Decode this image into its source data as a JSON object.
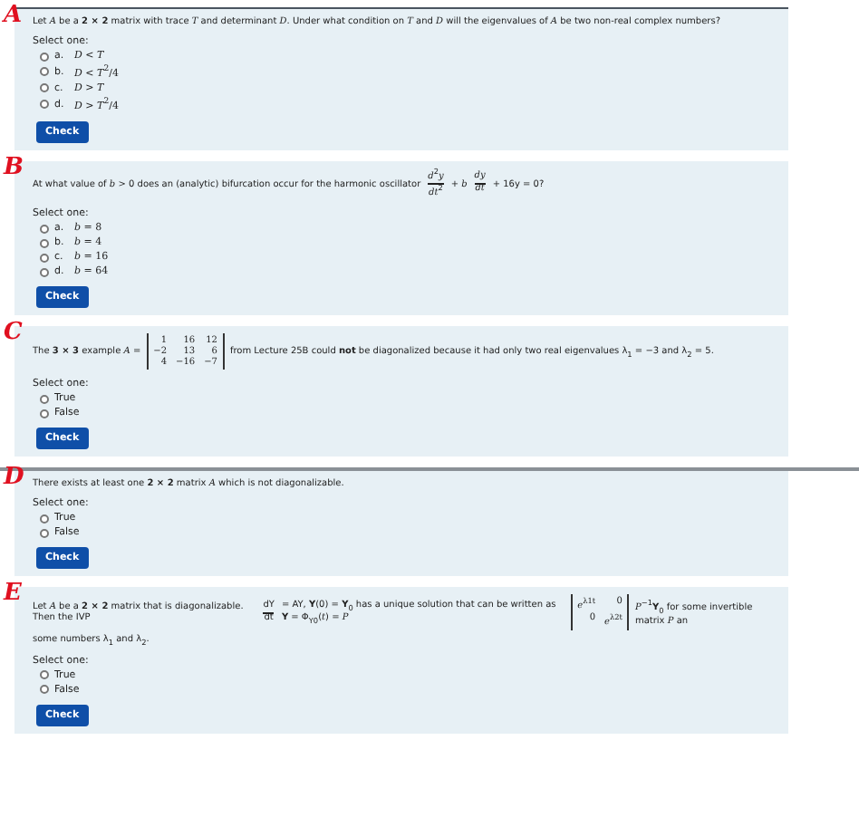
{
  "questions": [
    {
      "annotation": "A",
      "lines": [
        [
          {
            "kind": "text",
            "text": "Let *A* be a **2 × 2** matrix with trace *T* and determinant *D*. Under what condition on *T* and *D* will the eigenvalues of *A* be two non-real complex numbers?"
          }
        ]
      ],
      "select_label": "Select one:",
      "options": [
        {
          "letter": "a.",
          "text": "*D* < *T*",
          "selected": false
        },
        {
          "letter": "b.",
          "text": "*D* < *T*$^{2}$/4",
          "selected": false
        },
        {
          "letter": "c.",
          "text": "*D* > *T*",
          "selected": false
        },
        {
          "letter": "d.",
          "text": "*D* > *T*$^{2}$/4",
          "selected": false
        }
      ],
      "button": "Check"
    },
    {
      "annotation": "B",
      "lines": [
        [
          {
            "kind": "text",
            "text": "At what value of *b* > 0 does an (analytic) bifurcation occur for the harmonic oscillator"
          },
          {
            "kind": "fraction",
            "numerator": "*d*$^{2}$*y*",
            "denominator": "*dt*$^{2}$"
          },
          {
            "kind": "text",
            "text": "+ *b*"
          },
          {
            "kind": "fraction",
            "numerator": "*dy*",
            "denominator": "*dt*"
          },
          {
            "kind": "text",
            "text": "+ 16y = 0?"
          }
        ]
      ],
      "select_label": "Select one:",
      "options": [
        {
          "letter": "a.",
          "text": "*b* = 8",
          "selected": false
        },
        {
          "letter": "b.",
          "text": "*b* = 4",
          "selected": false
        },
        {
          "letter": "c.",
          "text": "*b* = 16",
          "selected": false
        },
        {
          "letter": "d.",
          "text": "*b* = 64",
          "selected": false
        }
      ],
      "button": "Check"
    },
    {
      "annotation": "C",
      "lines": [
        [
          {
            "kind": "text",
            "text": "The **3 × 3** example *A* ="
          },
          {
            "kind": "matrix",
            "rows": [
              [
                "1",
                "16",
                "12"
              ],
              [
                "−2",
                "13",
                "6"
              ],
              [
                "4",
                "−16",
                "−7"
              ]
            ]
          },
          {
            "kind": "text",
            "text": "from Lecture 25B could **not** be diagonalized because it had only two real eigenvalues λ$_{1}$ = −3 and λ$_{2}$ = 5."
          }
        ]
      ],
      "select_label": "Select one:",
      "options": [
        {
          "text": "True",
          "selected": false
        },
        {
          "text": "False",
          "selected": false
        }
      ],
      "button": "Check"
    },
    {
      "annotation": "D",
      "lines": [
        [
          {
            "kind": "text",
            "text": "There exists at least one **2 × 2** matrix *A* which is not diagonalizable."
          }
        ]
      ],
      "select_label": "Select one:",
      "options": [
        {
          "text": "True",
          "selected": false
        },
        {
          "text": "False",
          "selected": false
        }
      ],
      "button": "Check"
    },
    {
      "annotation": "E",
      "lines": [
        [
          {
            "kind": "text",
            "text": "Let *A* be a **2 × 2** matrix that is diagonalizable. Then the IVP"
          },
          {
            "kind": "fraction",
            "numerator": "dY",
            "denominator": "dt"
          },
          {
            "kind": "text",
            "text": "= AY, **Y**(0) = **Y**$_{0}$ has a unique solution that can be written as **Y** = Φ$_{Y0}$(*t*) = *P*"
          },
          {
            "kind": "matrix",
            "rows": [
              [
                "*e*$^{λ1t}$",
                "0"
              ],
              [
                "0",
                "*e*$^{λ2t}$"
              ]
            ]
          },
          {
            "kind": "text",
            "text": "*P*$^{−1}$**Y**$_{0}$ for some invertible matrix *P* an"
          }
        ],
        [
          {
            "kind": "text",
            "text": "some numbers λ$_{1}$ and λ$_{2}$."
          }
        ]
      ],
      "select_label": "Select one:",
      "options": [
        {
          "text": "True",
          "selected": false
        },
        {
          "text": "False",
          "selected": false
        }
      ],
      "button": "Check"
    }
  ]
}
